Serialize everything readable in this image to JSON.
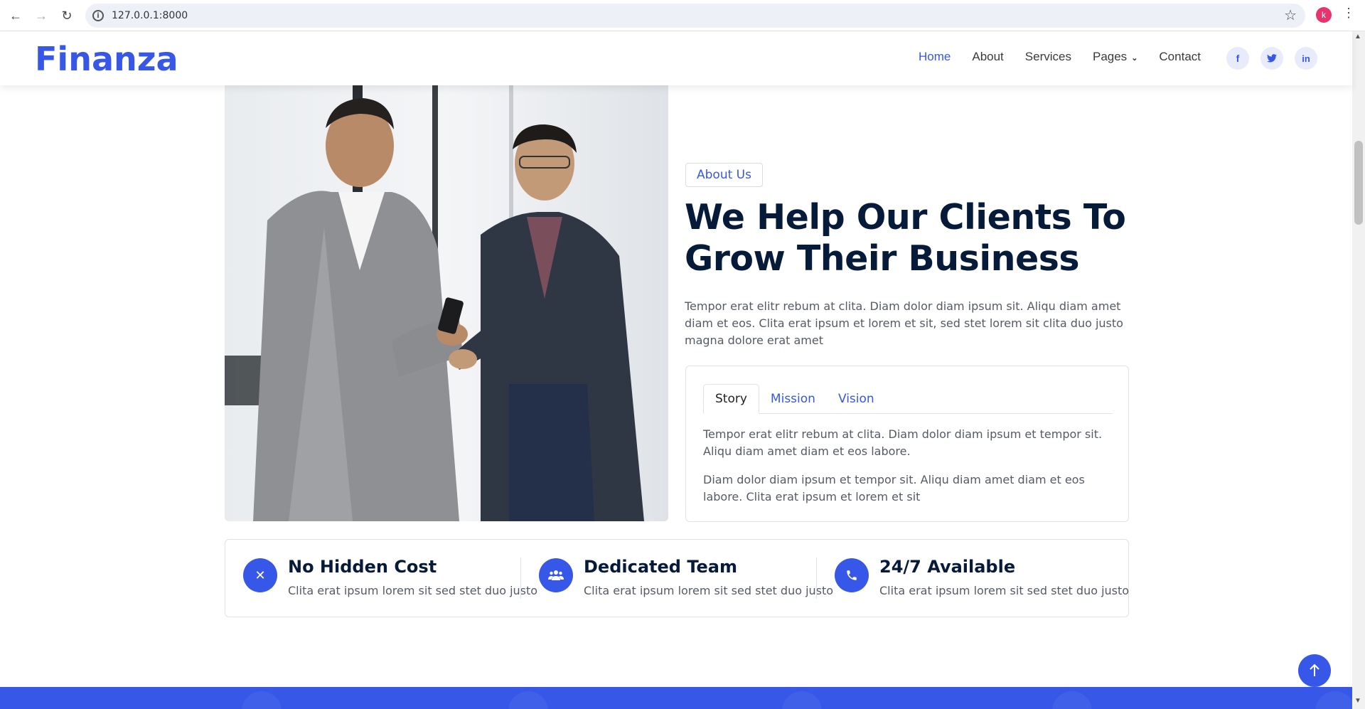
{
  "browser": {
    "url": "127.0.0.1:8000",
    "profile_initial": "k"
  },
  "navbar": {
    "brand": "Finanza",
    "links": [
      {
        "label": "Home",
        "active": true
      },
      {
        "label": "About",
        "active": false
      },
      {
        "label": "Services",
        "active": false
      },
      {
        "label": "Pages",
        "active": false,
        "dropdown": true
      },
      {
        "label": "Contact",
        "active": false
      }
    ],
    "social": [
      {
        "icon": "facebook-icon",
        "glyph": "f"
      },
      {
        "icon": "twitter-icon",
        "glyph": "t"
      },
      {
        "icon": "linkedin-icon",
        "glyph": "in"
      }
    ]
  },
  "about": {
    "badge": "About Us",
    "title": "We Help Our Clients To Grow Their Business",
    "text": "Tempor erat elitr rebum at clita. Diam dolor diam ipsum sit. Aliqu diam amet diam et eos. Clita erat ipsum et lorem et sit, sed stet lorem sit clita duo justo magna dolore erat amet",
    "tabs": [
      {
        "label": "Story",
        "active": true
      },
      {
        "label": "Mission",
        "active": false
      },
      {
        "label": "Vision",
        "active": false
      }
    ],
    "tab_paragraphs": [
      "Tempor erat elitr rebum at clita. Diam dolor diam ipsum et tempor sit. Aliqu diam amet diam et eos labore.",
      "Diam dolor diam ipsum et tempor sit. Aliqu diam amet diam et eos labore. Clita erat ipsum et lorem et sit"
    ]
  },
  "features": [
    {
      "icon": "times-icon",
      "title": "No Hidden Cost",
      "text": "Clita erat ipsum lorem sit sed stet duo justo"
    },
    {
      "icon": "users-icon",
      "title": "Dedicated Team",
      "text": "Clita erat ipsum lorem sit sed stet duo justo"
    },
    {
      "icon": "phone-icon",
      "title": "24/7 Available",
      "text": "Clita erat ipsum lorem sit sed stet duo justo"
    }
  ],
  "colors": {
    "primary": "#3657e8",
    "heading": "#061a3a",
    "body_text": "#555b66"
  }
}
